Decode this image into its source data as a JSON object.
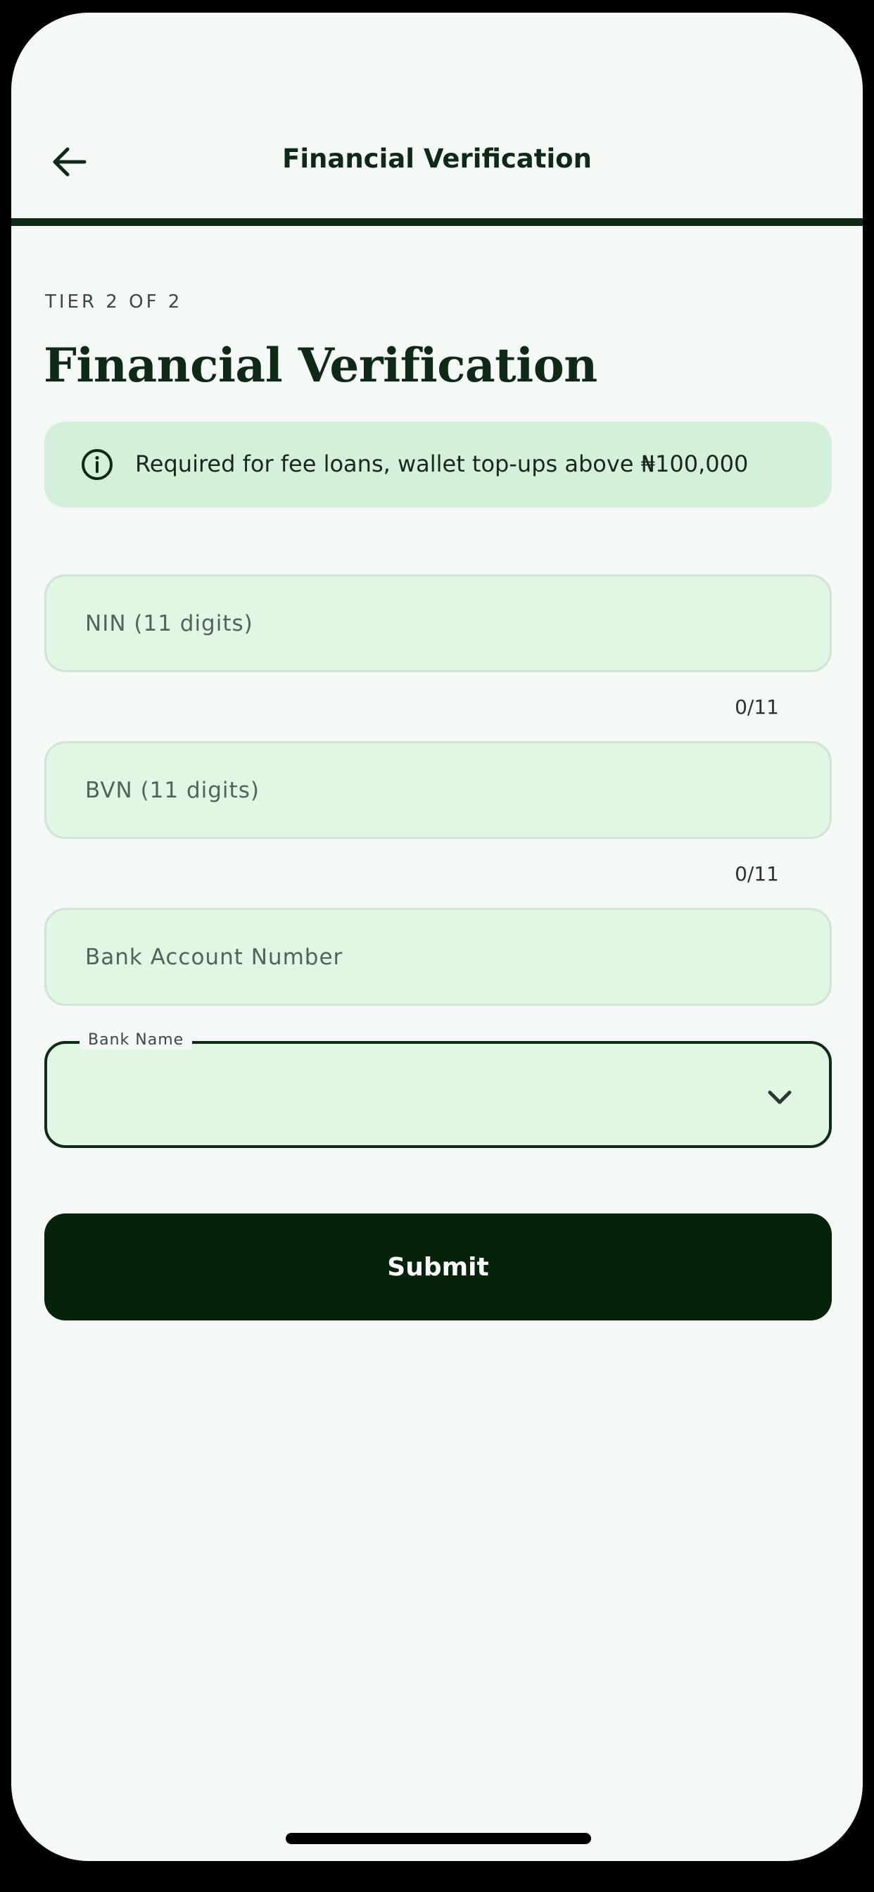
{
  "appbar": {
    "title": "Financial Verification",
    "back_icon": "arrow-left-icon"
  },
  "progress": {
    "fraction": 1.0
  },
  "header": {
    "tier_label": "TIER 2 OF 2",
    "title": "Financial Verification"
  },
  "info_banner": {
    "icon": "info-circle-icon",
    "text": "Required for fee loans, wallet top-ups above ₦100,000"
  },
  "form": {
    "nin": {
      "placeholder": "NIN (11 digits)",
      "value": "",
      "counter": "0/11"
    },
    "bvn": {
      "placeholder": "BVN (11 digits)",
      "value": "",
      "counter": "0/11"
    },
    "account": {
      "placeholder": "Bank Account Number",
      "value": ""
    },
    "bank": {
      "label": "Bank Name",
      "value": "",
      "icon": "chevron-down-icon"
    }
  },
  "submit_label": "Submit",
  "colors": {
    "background": "#F4F9F5",
    "primary": "#042409",
    "field_bg": "#E0F7E4",
    "banner_bg": "#D4EFDA"
  }
}
